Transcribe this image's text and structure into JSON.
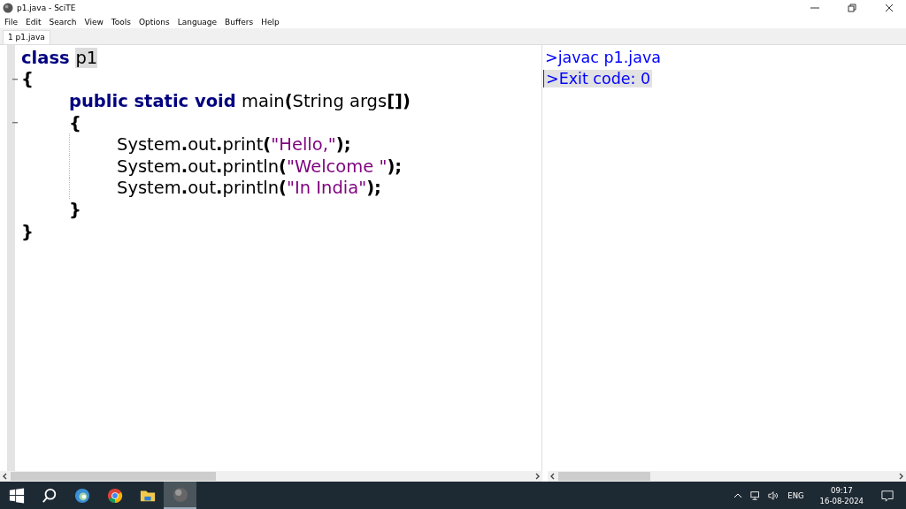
{
  "window": {
    "title": "p1.java - SciTE"
  },
  "menu": [
    "File",
    "Edit",
    "Search",
    "View",
    "Tools",
    "Options",
    "Language",
    "Buffers",
    "Help"
  ],
  "tabs": [
    {
      "label": "1 p1.java",
      "selected": true
    }
  ],
  "code": [
    {
      "tokens": [
        {
          "kind": "keyword",
          "text": "class "
        },
        {
          "kind": "plain",
          "text": "p1",
          "highlighted": true
        }
      ]
    },
    {
      "tokens": [
        {
          "kind": "op",
          "text": "{"
        }
      ],
      "children": [
        {
          "tokens": [
            {
              "kind": "keyword",
              "text": "public static void"
            },
            {
              "kind": "plain",
              "text": " main"
            },
            {
              "kind": "op",
              "text": "("
            },
            {
              "kind": "plain",
              "text": "String args"
            },
            {
              "kind": "op",
              "text": "[])"
            }
          ]
        },
        {
          "tokens": [
            {
              "kind": "op",
              "text": "{"
            }
          ],
          "children": [
            {
              "tokens": [
                {
                  "kind": "plain",
                  "text": "System"
                },
                {
                  "kind": "op",
                  "text": "."
                },
                {
                  "kind": "plain",
                  "text": "out"
                },
                {
                  "kind": "op",
                  "text": "."
                },
                {
                  "kind": "plain",
                  "text": "print"
                },
                {
                  "kind": "op",
                  "text": "("
                },
                {
                  "kind": "string",
                  "text": "\"Hello,\""
                },
                {
                  "kind": "op",
                  "text": ");"
                }
              ]
            },
            {
              "tokens": [
                {
                  "kind": "plain",
                  "text": "System"
                },
                {
                  "kind": "op",
                  "text": "."
                },
                {
                  "kind": "plain",
                  "text": "out"
                },
                {
                  "kind": "op",
                  "text": "."
                },
                {
                  "kind": "plain",
                  "text": "println"
                },
                {
                  "kind": "op",
                  "text": "("
                },
                {
                  "kind": "string",
                  "text": "\"Welcome \""
                },
                {
                  "kind": "op",
                  "text": ");"
                }
              ]
            },
            {
              "tokens": [
                {
                  "kind": "plain",
                  "text": "System"
                },
                {
                  "kind": "op",
                  "text": "."
                },
                {
                  "kind": "plain",
                  "text": "out"
                },
                {
                  "kind": "op",
                  "text": "."
                },
                {
                  "kind": "plain",
                  "text": "println"
                },
                {
                  "kind": "op",
                  "text": "("
                },
                {
                  "kind": "string",
                  "text": "\"In India\""
                },
                {
                  "kind": "op",
                  "text": ");"
                }
              ]
            }
          ]
        },
        {
          "tokens": [
            {
              "kind": "op",
              "text": "}"
            }
          ]
        }
      ]
    },
    {
      "tokens": [
        {
          "kind": "op",
          "text": "}"
        }
      ]
    }
  ],
  "output": [
    {
      "text": ">javac p1.java",
      "current": false
    },
    {
      "text": ">Exit code: 0",
      "current": true
    }
  ],
  "taskbar": {
    "apps": [
      {
        "kind": "windows",
        "selected": false
      },
      {
        "kind": "search",
        "selected": false
      },
      {
        "kind": "edge",
        "selected": false
      },
      {
        "kind": "chrome",
        "selected": false
      },
      {
        "kind": "folder",
        "selected": false
      },
      {
        "kind": "scite",
        "selected": true
      }
    ],
    "language": "ENG",
    "time": "09:17",
    "date": "16-08-2024"
  }
}
